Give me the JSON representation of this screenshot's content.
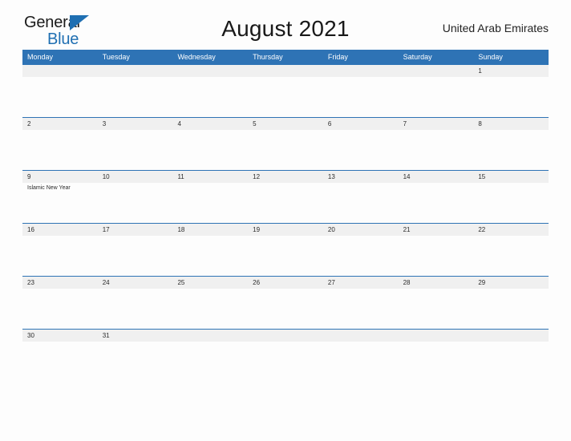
{
  "brand": {
    "line1": "General",
    "line2": "Blue",
    "triangle_icon": "triangle-icon",
    "color_dark": "#1b1b1b",
    "color_blue": "#1f6fb2"
  },
  "header": {
    "title": "August 2021",
    "country": "United Arab Emirates"
  },
  "theme": {
    "header_blue": "#2e73b5",
    "number_strip_gray": "#f0f0f0",
    "page_background": "#fdfdfd",
    "text_dark": "#2b2b2b"
  },
  "calendar": {
    "weekday_headers": [
      "Monday",
      "Tuesday",
      "Wednesday",
      "Thursday",
      "Friday",
      "Saturday",
      "Sunday"
    ],
    "weeks": [
      {
        "days": [
          {
            "number": "",
            "event": ""
          },
          {
            "number": "",
            "event": ""
          },
          {
            "number": "",
            "event": ""
          },
          {
            "number": "",
            "event": ""
          },
          {
            "number": "",
            "event": ""
          },
          {
            "number": "",
            "event": ""
          },
          {
            "number": "1",
            "event": ""
          }
        ]
      },
      {
        "days": [
          {
            "number": "2",
            "event": ""
          },
          {
            "number": "3",
            "event": ""
          },
          {
            "number": "4",
            "event": ""
          },
          {
            "number": "5",
            "event": ""
          },
          {
            "number": "6",
            "event": ""
          },
          {
            "number": "7",
            "event": ""
          },
          {
            "number": "8",
            "event": ""
          }
        ]
      },
      {
        "days": [
          {
            "number": "9",
            "event": "Islamic New Year"
          },
          {
            "number": "10",
            "event": ""
          },
          {
            "number": "11",
            "event": ""
          },
          {
            "number": "12",
            "event": ""
          },
          {
            "number": "13",
            "event": ""
          },
          {
            "number": "14",
            "event": ""
          },
          {
            "number": "15",
            "event": ""
          }
        ]
      },
      {
        "days": [
          {
            "number": "16",
            "event": ""
          },
          {
            "number": "17",
            "event": ""
          },
          {
            "number": "18",
            "event": ""
          },
          {
            "number": "19",
            "event": ""
          },
          {
            "number": "20",
            "event": ""
          },
          {
            "number": "21",
            "event": ""
          },
          {
            "number": "22",
            "event": ""
          }
        ]
      },
      {
        "days": [
          {
            "number": "23",
            "event": ""
          },
          {
            "number": "24",
            "event": ""
          },
          {
            "number": "25",
            "event": ""
          },
          {
            "number": "26",
            "event": ""
          },
          {
            "number": "27",
            "event": ""
          },
          {
            "number": "28",
            "event": ""
          },
          {
            "number": "29",
            "event": ""
          }
        ]
      },
      {
        "days": [
          {
            "number": "30",
            "event": ""
          },
          {
            "number": "31",
            "event": ""
          },
          {
            "number": "",
            "event": ""
          },
          {
            "number": "",
            "event": ""
          },
          {
            "number": "",
            "event": ""
          },
          {
            "number": "",
            "event": ""
          },
          {
            "number": "",
            "event": ""
          }
        ]
      }
    ]
  }
}
